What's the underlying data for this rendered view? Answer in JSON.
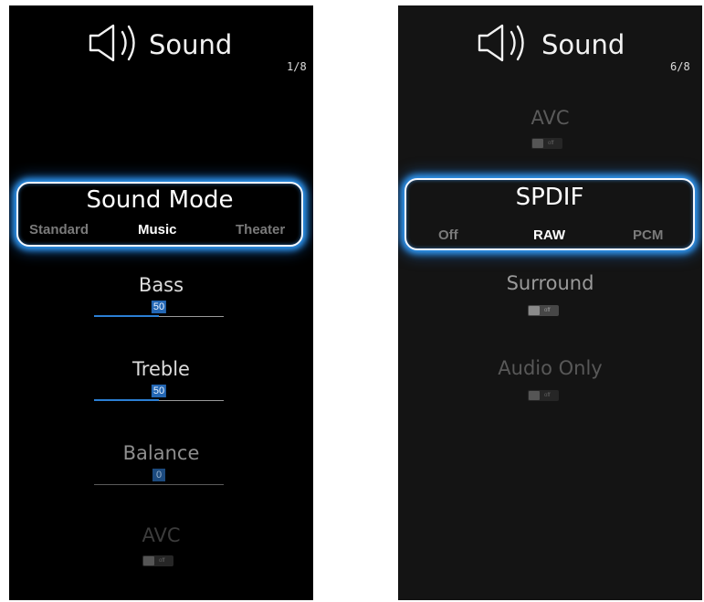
{
  "left": {
    "header": {
      "title": "Sound",
      "page": "1/8",
      "icon": "speaker-icon"
    },
    "sound_mode": {
      "title": "Sound Mode",
      "options": [
        "Standard",
        "Music",
        "Theater"
      ],
      "selected": "Music"
    },
    "bass": {
      "label": "Bass",
      "value": "50"
    },
    "treble": {
      "label": "Treble",
      "value": "50"
    },
    "balance": {
      "label": "Balance",
      "value": "0"
    },
    "avc": {
      "label": "AVC",
      "toggle": "off"
    }
  },
  "right": {
    "header": {
      "title": "Sound",
      "page": "6/8",
      "icon": "speaker-icon"
    },
    "avc": {
      "label": "AVC",
      "toggle": "off"
    },
    "spdif": {
      "title": "SPDIF",
      "options": [
        "Off",
        "RAW",
        "PCM"
      ],
      "selected": "RAW"
    },
    "surround": {
      "label": "Surround",
      "toggle": "off"
    },
    "audio_only": {
      "label": "Audio Only",
      "toggle": "off"
    }
  },
  "colors": {
    "focus_glow": "#32a0ff",
    "slider_fill": "#2b7fd4",
    "panel_left_bg": "#000000",
    "panel_right_bg": "#141414"
  }
}
